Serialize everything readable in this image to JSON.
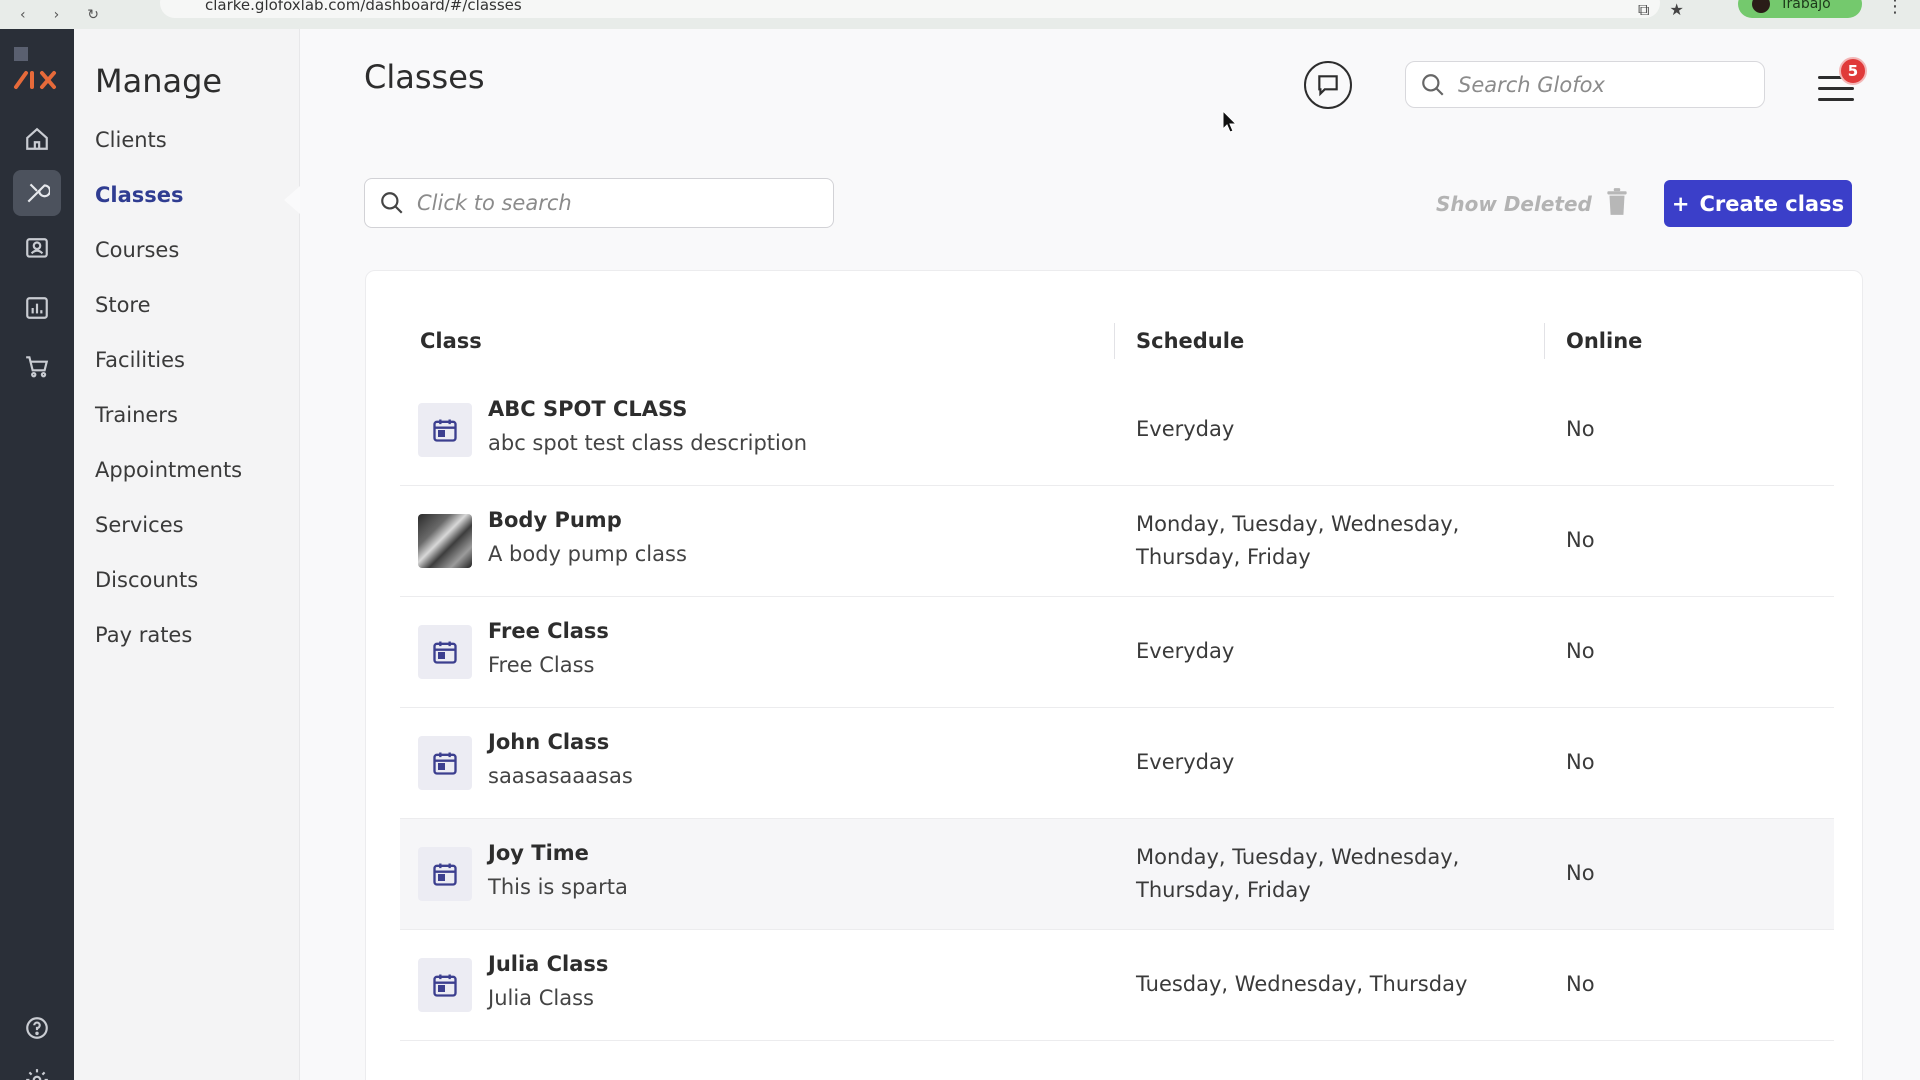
{
  "browser": {
    "url": "clarke.glofoxlab.com/dashboard/#/classes",
    "profile_label": "Trabajo"
  },
  "rail": {
    "items": [
      {
        "icon": "home-icon",
        "active": false
      },
      {
        "icon": "wrench-icon",
        "active": true
      },
      {
        "icon": "contacts-icon",
        "active": false
      },
      {
        "icon": "analytics-icon",
        "active": false
      },
      {
        "icon": "cart-icon",
        "active": false
      }
    ],
    "bottom": [
      {
        "icon": "help-icon"
      },
      {
        "icon": "settings-icon"
      }
    ]
  },
  "manage": {
    "title": "Manage",
    "items": [
      {
        "label": "Clients"
      },
      {
        "label": "Classes",
        "active": true
      },
      {
        "label": "Courses"
      },
      {
        "label": "Store"
      },
      {
        "label": "Facilities"
      },
      {
        "label": "Trainers"
      },
      {
        "label": "Appointments"
      },
      {
        "label": "Services"
      },
      {
        "label": "Discounts"
      },
      {
        "label": "Pay rates"
      }
    ]
  },
  "header": {
    "title": "Classes",
    "global_search_placeholder": "Search Glofox",
    "notification_count": "5"
  },
  "toolbar": {
    "search_placeholder": "Click to search",
    "show_deleted_label": "Show Deleted",
    "create_label": "Create class"
  },
  "table": {
    "columns": [
      "Class",
      "Schedule",
      "Online"
    ],
    "rows": [
      {
        "name": "ABC SPOT CLASS",
        "description": "abc spot test class description",
        "schedule": "Everyday",
        "online": "No",
        "thumb": "calendar-icon"
      },
      {
        "name": "Body Pump",
        "description": "A body pump class",
        "schedule": "Monday, Tuesday, Wednesday, Thursday, Friday",
        "online": "No",
        "thumb": "photo"
      },
      {
        "name": "Free Class",
        "description": "Free Class",
        "schedule": "Everyday",
        "online": "No",
        "thumb": "calendar-icon"
      },
      {
        "name": "John Class",
        "description": "saasasaaasas",
        "schedule": "Everyday",
        "online": "No",
        "thumb": "calendar-icon"
      },
      {
        "name": "Joy Time",
        "description": "This is sparta",
        "schedule": "Monday, Tuesday, Wednesday, Thursday, Friday",
        "online": "No",
        "thumb": "calendar-icon"
      },
      {
        "name": "Julia Class",
        "description": "Julia Class",
        "schedule": "Tuesday, Wednesday, Thursday",
        "online": "No",
        "thumb": "calendar-icon"
      }
    ]
  },
  "colors": {
    "accent": "#3b3fc9",
    "active_nav": "#2f3c91",
    "rail_bg": "#2a2f38",
    "badge": "#e03a3a"
  }
}
